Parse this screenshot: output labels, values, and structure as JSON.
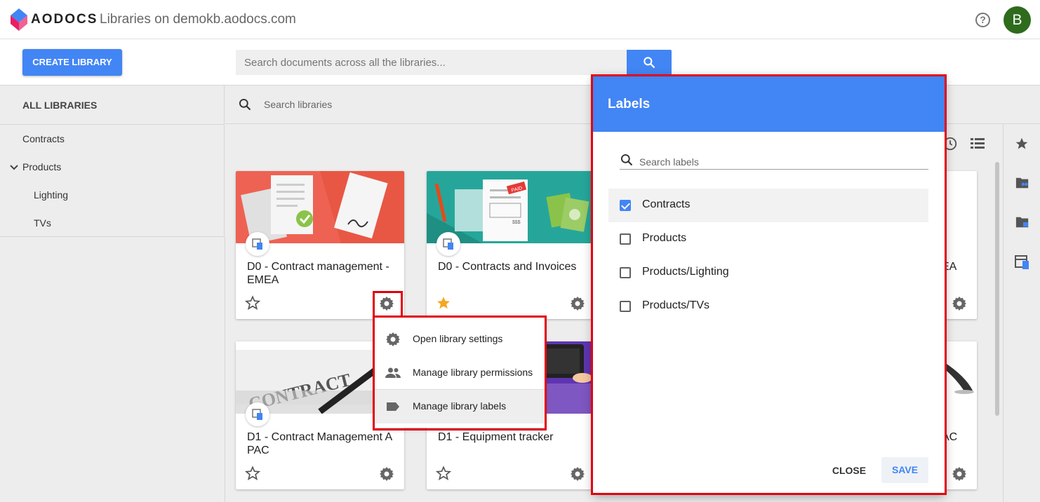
{
  "header": {
    "brand": "AODOCS",
    "title": "Libraries on demokb.aodocs.com",
    "help_label": "?",
    "avatar_letter": "B",
    "avatar_color": "#2e6b1d"
  },
  "actionbar": {
    "create_label": "CREATE LIBRARY",
    "search_placeholder": "Search documents across all the libraries..."
  },
  "sidebar": {
    "all_label": "ALL LIBRARIES",
    "items": [
      {
        "label": "Contracts"
      },
      {
        "label": "Products"
      },
      {
        "label": "Lighting"
      },
      {
        "label": "TVs"
      }
    ]
  },
  "library_search": {
    "placeholder": "Search libraries"
  },
  "cards": [
    {
      "title": "D0 - Contract management - EMEA",
      "starred": false
    },
    {
      "title": "D0 - Contracts and Invoices",
      "starred": true
    },
    {
      "title": "EA",
      "starred": false
    },
    {
      "title": "D1 - Contract Management A PAC",
      "starred": false
    },
    {
      "title": "D1 - Equipment tracker",
      "starred": false
    },
    {
      "title": "AC",
      "starred": false
    }
  ],
  "banner_texts": {
    "paid": "PAID",
    "amount": "$$$",
    "contract": "CONTRACT"
  },
  "context_menu": {
    "items": [
      {
        "label": "Open library settings",
        "icon": "gear-icon"
      },
      {
        "label": "Manage library permissions",
        "icon": "people-icon"
      },
      {
        "label": "Manage library labels",
        "icon": "label-icon"
      }
    ]
  },
  "labels_dialog": {
    "title": "Labels",
    "search_placeholder": "Search labels",
    "labels": [
      {
        "name": "Contracts",
        "checked": true
      },
      {
        "name": "Products",
        "checked": false
      },
      {
        "name": "Products/Lighting",
        "checked": false
      },
      {
        "name": "Products/TVs",
        "checked": false
      }
    ],
    "close_label": "CLOSE",
    "save_label": "SAVE"
  },
  "colors": {
    "accent": "#4285f4",
    "highlight_frame": "#e3000f",
    "star_active": "#f5a623"
  }
}
